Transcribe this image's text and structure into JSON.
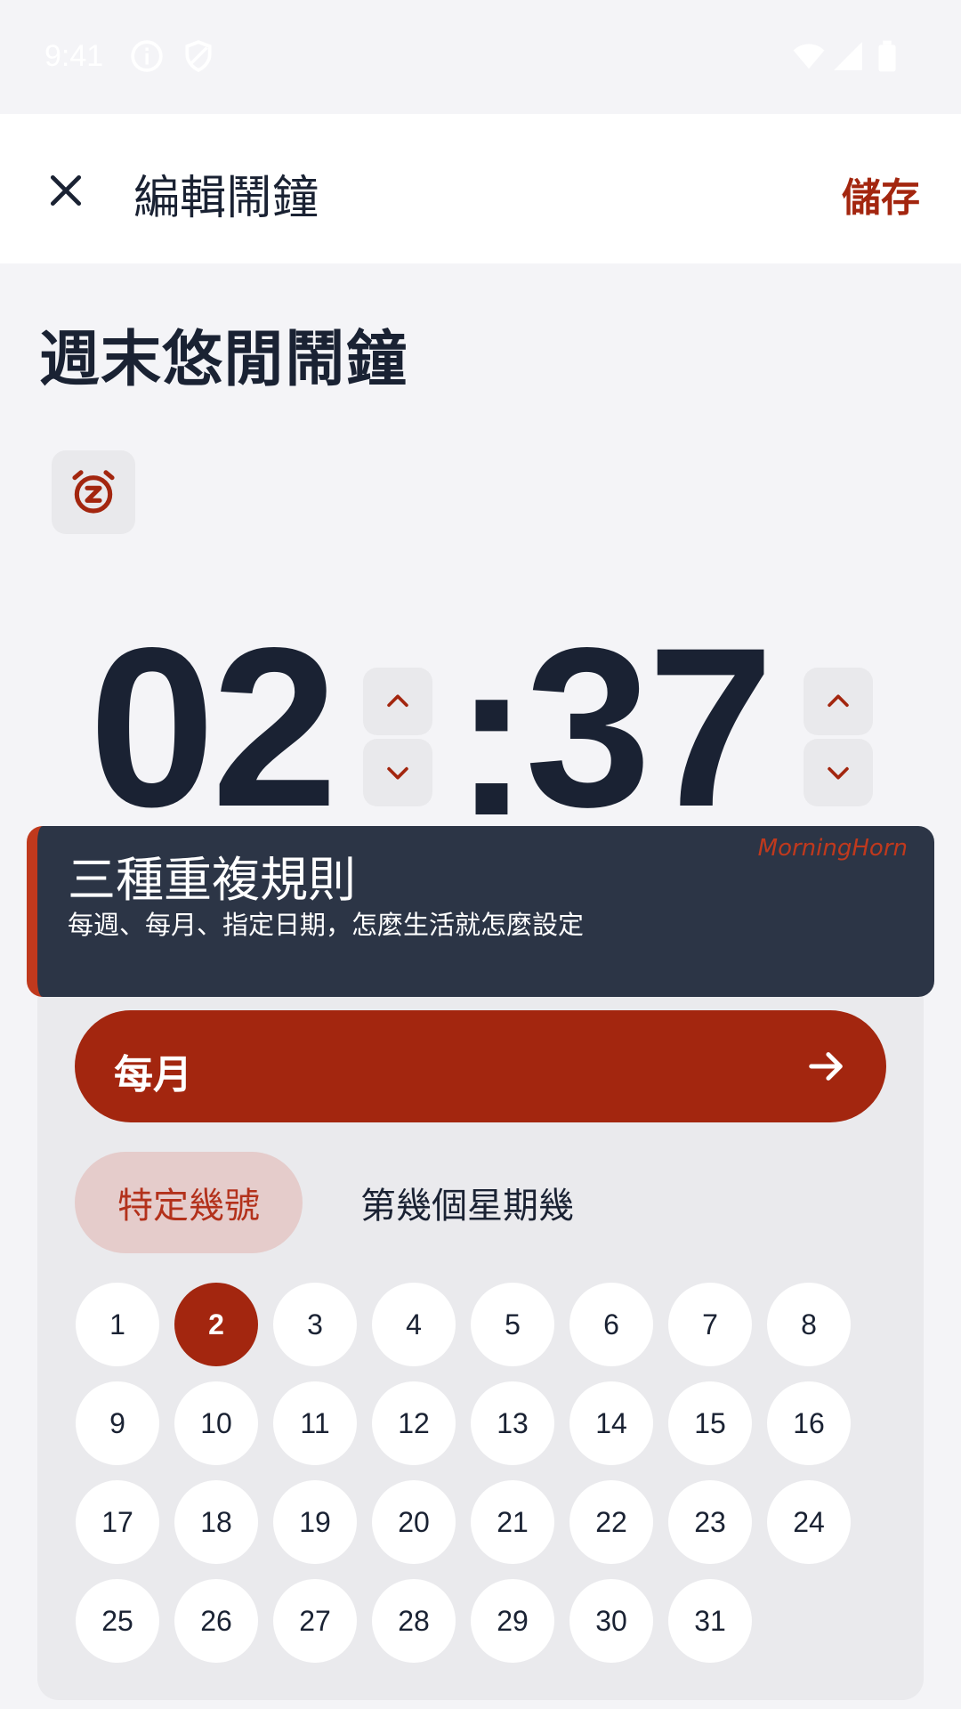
{
  "status_bar": {
    "time": "9:41"
  },
  "header": {
    "title": "編輯鬧鐘",
    "save_label": "儲存"
  },
  "alarm": {
    "name": "週末悠閒鬧鐘",
    "hour": "02",
    "minute": "37",
    "separator": ":"
  },
  "promo": {
    "title": "三種重複規則",
    "subtitle": "每週、每月、指定日期，怎麼生活就怎麼設定",
    "brand": "MorningHorn"
  },
  "repeat": {
    "mode_label": "每月",
    "tabs": [
      {
        "label": "特定幾號",
        "active": true
      },
      {
        "label": "第幾個星期幾",
        "active": false
      }
    ],
    "days": [
      "1",
      "2",
      "3",
      "4",
      "5",
      "6",
      "7",
      "8",
      "9",
      "10",
      "11",
      "12",
      "13",
      "14",
      "15",
      "16",
      "17",
      "18",
      "19",
      "20",
      "21",
      "22",
      "23",
      "24",
      "25",
      "26",
      "27",
      "28",
      "29",
      "30",
      "31"
    ],
    "selected_day": "2"
  },
  "colors": {
    "accent": "#a3260f",
    "dark": "#1a2233",
    "promo_bg": "#2c3546"
  }
}
